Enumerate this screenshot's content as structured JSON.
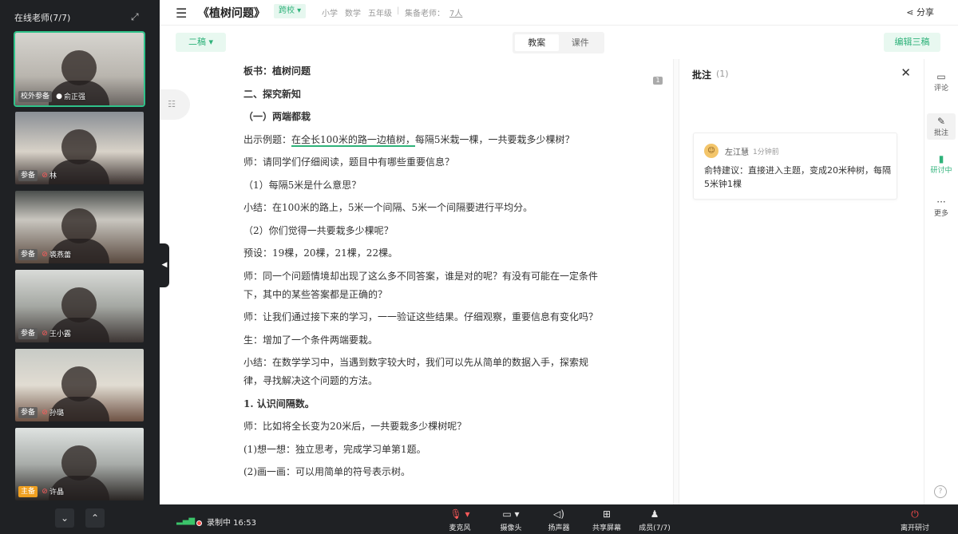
{
  "left_panel": {
    "title": "在线老师(7/7)",
    "participants": [
      {
        "tag": "校外参备",
        "mic": "on",
        "name": "俞正强",
        "active": true
      },
      {
        "tag": "参备",
        "mic": "off",
        "name": "林"
      },
      {
        "tag": "参备",
        "mic": "off",
        "name": "裘燕蕾"
      },
      {
        "tag": "参备",
        "mic": "off",
        "name": "王小露"
      },
      {
        "tag": "参备",
        "mic": "off",
        "name": "孙璐"
      },
      {
        "tag": "主备",
        "mic": "off",
        "name": "许晶",
        "host": true
      }
    ],
    "nav_down": "⌄",
    "nav_up": "⌃"
  },
  "header": {
    "menu_icon": "menu-icon",
    "title": "《植树问题》",
    "badge": "跨校 ▾",
    "stage": "小学",
    "subject": "数学",
    "grade": "五年级",
    "group_label": "集备老师：",
    "group_count": "7人",
    "share": "分享"
  },
  "toolbar": {
    "draft": "二稿 ▾",
    "tabs": [
      "教案",
      "课件"
    ],
    "active_tab": 0,
    "edit": "编辑三稿"
  },
  "document": {
    "paragraphs": [
      {
        "text": "板书：植树问题",
        "bold": true
      },
      {
        "text": "二、探究新知",
        "bold": true
      },
      {
        "text": "（一）两端都栽",
        "bold": true
      },
      {
        "pre": "出示例题：",
        "hl": "在全长100米的路一边植树，",
        "post": "每隔5米栽一棵，一共要栽多少棵树？"
      },
      {
        "text": "师：请同学们仔细阅读，题目中有哪些重要信息？"
      },
      {
        "text": "（1）每隔5米是什么意思？"
      },
      {
        "text": "小结：在100米的路上，5米一个间隔、5米一个间隔要进行平均分。"
      },
      {
        "text": "（2）你们觉得一共要栽多少棵呢？"
      },
      {
        "text": "预设：19棵，20棵，21棵，22棵。"
      },
      {
        "text": "师：同一个问题情境却出现了这么多不同答案，谁是对的呢？有没有可能在一定条件下，其中的某些答案都是正确的？"
      },
      {
        "text": "师：让我们通过接下来的学习，一一验证这些结果。仔细观察，重要信息有变化吗？"
      },
      {
        "text": "生：增加了一个条件两端要栽。"
      },
      {
        "text": "小结：在数学学习中，当遇到数字较大时，我们可以先从简单的数据入手，探索规律，寻找解决这个问题的方法。"
      },
      {
        "text": "1. 认识间隔数。",
        "bold": true
      },
      {
        "text": "师：比如将全长变为20米后，一共要栽多少棵树呢？"
      },
      {
        "text": "(1)想一想：独立思考，完成学习单第1题。"
      },
      {
        "text": "(2)画一画：可以用简单的符号表示树。"
      }
    ],
    "comment_marker": "1"
  },
  "annotations": {
    "title": "批注",
    "count": "(1)",
    "items": [
      {
        "author": "左江慧",
        "time": "1分钟前",
        "text": "俞特建议：直接进入主题，变成20米种树，每隔5米钟1棵"
      }
    ]
  },
  "rail": [
    {
      "icon": "comment-icon",
      "glyph": "▭",
      "label": "评论"
    },
    {
      "icon": "pen-icon",
      "glyph": "✎",
      "label": "批注",
      "active": true
    },
    {
      "icon": "bar-chart-icon",
      "glyph": "▮",
      "label": "研讨中",
      "green": true
    },
    {
      "icon": "more-icon",
      "glyph": "···",
      "label": "更多"
    }
  ],
  "bottombar": {
    "recording": "录制中 16:53",
    "controls": [
      {
        "label": "麦克风",
        "glyph": "🎙 ▾",
        "icon": "microphone-icon",
        "off": true
      },
      {
        "label": "摄像头",
        "glyph": "▭ ▾",
        "icon": "camera-icon"
      },
      {
        "label": "扬声器",
        "glyph": "◁)",
        "icon": "speaker-icon"
      },
      {
        "label": "共享屏幕",
        "glyph": "⊞",
        "icon": "share-screen-icon"
      },
      {
        "label": "成员(7/7)",
        "glyph": "♟",
        "icon": "members-icon"
      }
    ],
    "leave": "离开研讨"
  },
  "colors": {
    "accent": "#2fb27a",
    "dark": "#1f2124",
    "danger": "#ff4d4d"
  }
}
